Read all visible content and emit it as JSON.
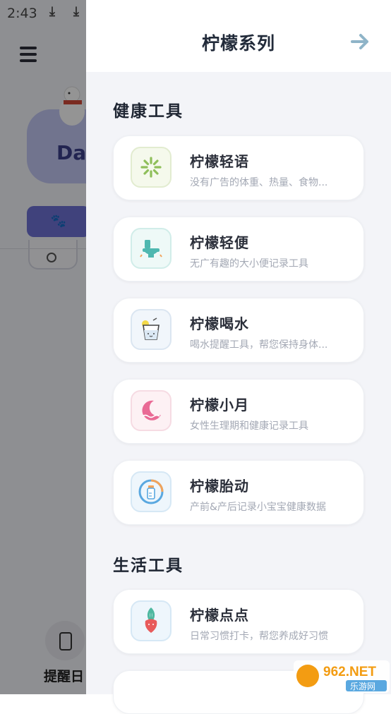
{
  "status_bar": {
    "time": "2:43",
    "notification_icons": [
      "download-icon",
      "download-icon",
      "download-icon",
      "a-icon",
      "dot-icon"
    ],
    "system_icons": [
      "wifi-icon",
      "signal-icon",
      "battery-charging-icon"
    ]
  },
  "background_app": {
    "card_text": "Da",
    "bottom_label": "提醒日"
  },
  "drawer": {
    "title": "柠檬系列",
    "sections": [
      {
        "title": "健康工具",
        "items": [
          {
            "name": "柠檬轻语",
            "desc": "没有广告的体重、热量、食物...",
            "icon": "lemon-slice-icon"
          },
          {
            "name": "柠檬轻便",
            "desc": "无广有趣的大小便记录工具",
            "icon": "toilet-icon"
          },
          {
            "name": "柠檬喝水",
            "desc": "喝水提醒工具，帮您保持身体...",
            "icon": "water-glass-icon"
          },
          {
            "name": "柠檬小月",
            "desc": "女性生理期和健康记录工具",
            "icon": "moon-icon"
          },
          {
            "name": "柠檬胎动",
            "desc": "产前&产后记录小宝宝健康数据",
            "icon": "baby-bottle-icon"
          }
        ]
      },
      {
        "title": "生活工具",
        "items": [
          {
            "name": "柠檬点点",
            "desc": "日常习惯打卡，帮您养成好习惯",
            "icon": "radish-icon"
          }
        ]
      }
    ]
  },
  "watermark": {
    "text": "962.NET",
    "subtext": "乐游网"
  },
  "colors": {
    "drawer_bg": "#f3f4f8",
    "card_bg": "#ffffff",
    "arrow": "#8fb4c8",
    "lemon_green": "#8fbf5a",
    "toilet_teal": "#4fb8b0",
    "water_blue": "#8ab8d8",
    "moon_pink": "#e96a95",
    "bottle_blue": "#5aa8e0",
    "radish_red": "#e85b5b"
  }
}
